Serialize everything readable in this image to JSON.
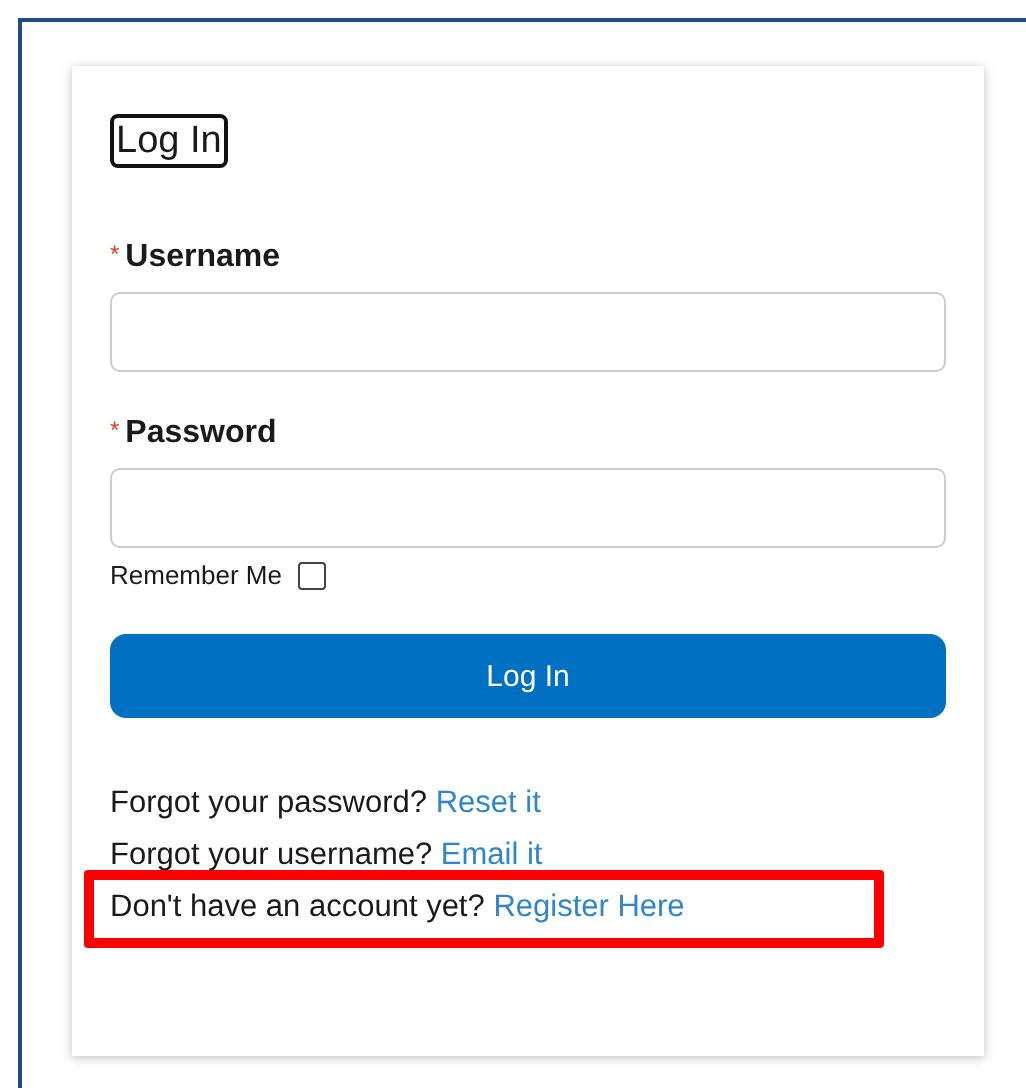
{
  "title": "Log In",
  "fields": [
    {
      "label": "Username",
      "required_mark": "*"
    },
    {
      "label": "Password",
      "required_mark": "*"
    }
  ],
  "remember": {
    "label": "Remember Me",
    "checked": false
  },
  "button": "Log In",
  "help_lines": [
    {
      "text": "Forgot your password?",
      "link": "Reset it",
      "highlighted": false
    },
    {
      "text": "Forgot your username?",
      "link": "Email it",
      "highlighted": false
    },
    {
      "text": "Don't have an account yet?",
      "link": "Register Here",
      "highlighted": true
    }
  ]
}
